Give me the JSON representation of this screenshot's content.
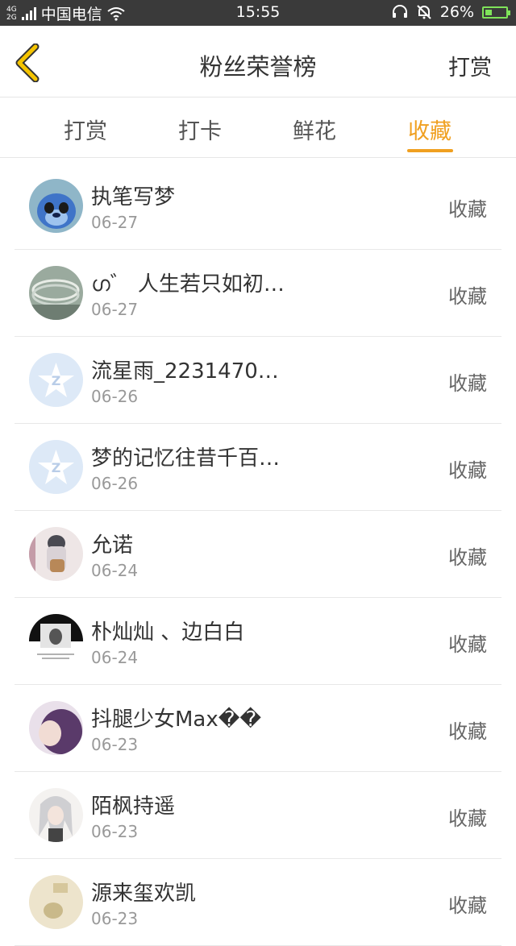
{
  "status_bar": {
    "network": "4G\n2G",
    "carrier": "中国电信",
    "time": "15:55",
    "battery": "26%"
  },
  "header": {
    "title": "粉丝荣誉榜",
    "action": "打赏"
  },
  "tabs": [
    {
      "label": "打赏",
      "active": false
    },
    {
      "label": "打卡",
      "active": false
    },
    {
      "label": "鲜花",
      "active": false
    },
    {
      "label": "收藏",
      "active": true
    }
  ],
  "colors": {
    "accent": "#f0a020",
    "back_icon": "#f5c400"
  },
  "list": [
    {
      "name": "执笔写梦",
      "date": "06-27",
      "action": "收藏"
    },
    {
      "name": "ഗ゛ 人生若只如初…",
      "date": "06-27",
      "action": "收藏"
    },
    {
      "name": "流星雨_2231470…",
      "date": "06-26",
      "action": "收藏"
    },
    {
      "name": "梦的记忆往昔千百…",
      "date": "06-26",
      "action": "收藏"
    },
    {
      "name": "允诺",
      "date": "06-24",
      "action": "收藏"
    },
    {
      "name": "朴灿灿 、边白白",
      "date": "06-24",
      "action": "收藏"
    },
    {
      "name": "抖腿少女Max��",
      "date": "06-23",
      "action": "收藏"
    },
    {
      "name": "陌枫持遥",
      "date": "06-23",
      "action": "收藏"
    },
    {
      "name": "源来玺欢凯",
      "date": "06-23",
      "action": "收藏"
    }
  ]
}
